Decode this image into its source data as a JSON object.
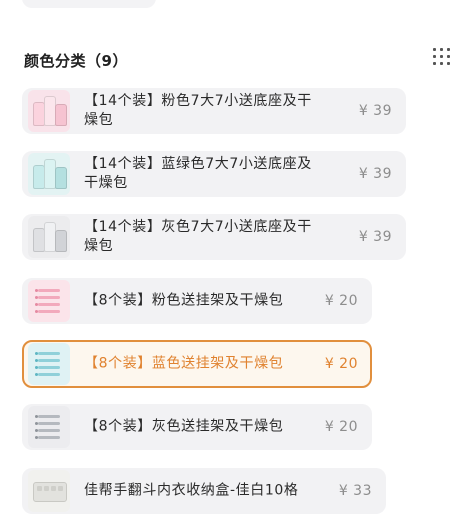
{
  "section": {
    "title": "颜色分类（9）"
  },
  "options": [
    {
      "label_line1": "【14个装】粉色7大7小送底座及干",
      "label_line2": "燥包",
      "price": "¥ 39",
      "thumb_color": "#f4c9d4",
      "selected": false
    },
    {
      "label_line1": "【14个装】蓝绿色7大7小送底座及",
      "label_line2": "干燥包",
      "price": "¥ 39",
      "thumb_color": "#bfe3e3",
      "selected": false
    },
    {
      "label_line1": "【14个装】灰色7大7小送底座及干",
      "label_line2": "燥包",
      "price": "¥ 39",
      "thumb_color": "#d5d7da",
      "selected": false
    },
    {
      "label_line1": "【8个装】粉色送挂架及干燥包",
      "label_line2": "",
      "price": "¥ 20",
      "thumb_color": "#f2b8c6",
      "selected": false
    },
    {
      "label_line1": "【8个装】蓝色送挂架及干燥包",
      "label_line2": "",
      "price": "¥ 20",
      "thumb_color": "#a9d8df",
      "selected": true
    },
    {
      "label_line1": "【8个装】灰色送挂架及干燥包",
      "label_line2": "",
      "price": "¥ 20",
      "thumb_color": "#c9ccd1",
      "selected": false
    },
    {
      "label_line1": "佳帮手翻斗内衣收纳盒-佳白10格",
      "label_line2": "",
      "price": "¥ 33",
      "thumb_color": "#e6e6e3",
      "selected": false
    }
  ],
  "icons": {
    "grid": "grid-view-icon"
  },
  "colors": {
    "accent": "#e0822f",
    "option_bg": "#f2f2f4",
    "selected_bg": "#fdf7ee"
  }
}
